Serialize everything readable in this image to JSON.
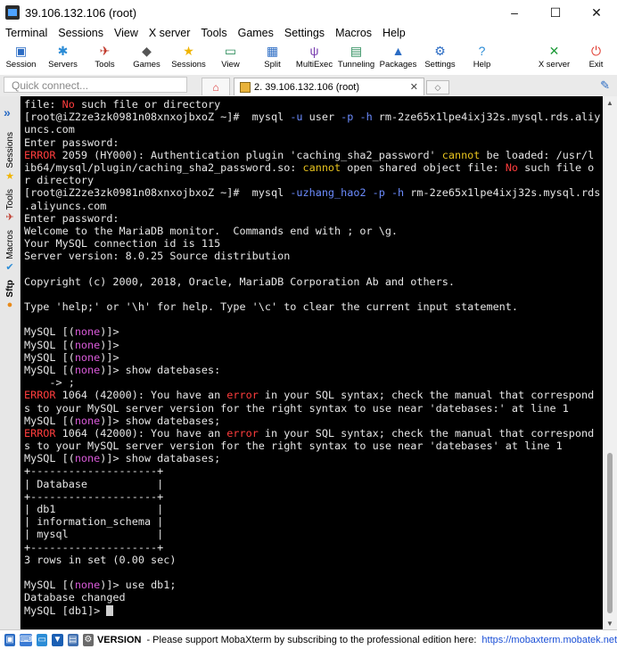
{
  "window": {
    "title": "39.106.132.106 (root)",
    "minimize": "–",
    "maximize": "☐",
    "close": "✕"
  },
  "menu": [
    "Terminal",
    "Sessions",
    "View",
    "X server",
    "Tools",
    "Games",
    "Settings",
    "Macros",
    "Help"
  ],
  "toolbar": [
    {
      "label": "Session",
      "icon": "session-icon",
      "glyph": "▣",
      "color": "#2b6cc4"
    },
    {
      "label": "Servers",
      "icon": "servers-icon",
      "glyph": "✱",
      "color": "#2b8cd6"
    },
    {
      "label": "Tools",
      "icon": "tools-icon",
      "glyph": "✈",
      "color": "#c0392b"
    },
    {
      "label": "Games",
      "icon": "games-icon",
      "glyph": "◆",
      "color": "#555555"
    },
    {
      "label": "Sessions",
      "icon": "sessions-star-icon",
      "glyph": "★",
      "color": "#f0b400"
    },
    {
      "label": "View",
      "icon": "view-icon",
      "glyph": "▭",
      "color": "#2b8c5a"
    },
    {
      "label": "Split",
      "icon": "split-icon",
      "glyph": "▦",
      "color": "#2b6cc4"
    },
    {
      "label": "MultiExec",
      "icon": "multiexec-icon",
      "glyph": "ψ",
      "color": "#7a3fb0"
    },
    {
      "label": "Tunneling",
      "icon": "tunneling-icon",
      "glyph": "▤",
      "color": "#2b8c5a"
    },
    {
      "label": "Packages",
      "icon": "packages-icon",
      "glyph": "▲",
      "color": "#2b6cc4"
    },
    {
      "label": "Settings",
      "icon": "settings-icon",
      "glyph": "⚙",
      "color": "#2b6cc4"
    },
    {
      "label": "Help",
      "icon": "help-icon",
      "glyph": "?",
      "color": "#2b8cd6"
    }
  ],
  "toolbar_right": [
    {
      "label": "X server",
      "icon": "x-server-icon",
      "glyph": "✕",
      "color": "#1f9b3a"
    },
    {
      "label": "Exit",
      "icon": "exit-power-icon",
      "glyph": "⏻",
      "color": "#e03a2f"
    }
  ],
  "tabs": {
    "quick_connect_placeholder": "Quick connect...",
    "session_tab_label": "2. 39.106.132.106 (root)",
    "session_tab_close": "✕",
    "new_tab": "◇"
  },
  "sidebar": {
    "tabs": [
      "Sessions",
      "Tools",
      "Macros",
      "Sftp"
    ]
  },
  "terminal": {
    "lines": [
      [
        {
          "t": "file: "
        },
        {
          "t": "No",
          "c": "red"
        },
        {
          "t": " such file or directory"
        }
      ],
      [
        {
          "t": "[root@iZ2ze3zk0981n08xnxojbxoZ ~]#  mysql "
        },
        {
          "t": "-u",
          "c": "blue"
        },
        {
          "t": " user "
        },
        {
          "t": "-p -h",
          "c": "blue"
        },
        {
          "t": " rm-2ze65x1lpe4ixj32s.mysql.rds.aliy"
        }
      ],
      [
        {
          "t": "uncs.com"
        }
      ],
      [
        {
          "t": "Enter password:"
        }
      ],
      [
        {
          "t": "ERROR",
          "c": "red"
        },
        {
          "t": " 2059 (HY000): Authentication plugin 'caching_sha2_password' "
        },
        {
          "t": "cannot",
          "c": "yel"
        },
        {
          "t": " be loaded: /usr/l"
        }
      ],
      [
        {
          "t": "ib64/mysql/plugin/caching_sha2_password.so: "
        },
        {
          "t": "cannot",
          "c": "yel"
        },
        {
          "t": " open shared object file: "
        },
        {
          "t": "No",
          "c": "red"
        },
        {
          "t": " such file o"
        }
      ],
      [
        {
          "t": "r directory"
        }
      ],
      [
        {
          "t": "[root@iZ2ze3zk0981n08xnxojbxoZ ~]#  mysql "
        },
        {
          "t": "-uzhang_hao2 -p -h",
          "c": "blue"
        },
        {
          "t": " rm-2ze65x1lpe4ixj32s.mysql.rds"
        }
      ],
      [
        {
          "t": ".aliyuncs.com"
        }
      ],
      [
        {
          "t": "Enter password:"
        }
      ],
      [
        {
          "t": "Welcome to the MariaDB monitor.  Commands end with ; or \\g."
        }
      ],
      [
        {
          "t": "Your MySQL connection id is 115"
        }
      ],
      [
        {
          "t": "Server version: 8.0.25 Source distribution"
        }
      ],
      [
        {
          "t": ""
        }
      ],
      [
        {
          "t": "Copyright (c) 2000, 2018, Oracle, MariaDB Corporation Ab and others."
        }
      ],
      [
        {
          "t": ""
        }
      ],
      [
        {
          "t": "Type 'help;' or '\\h' for help. Type '\\c' to clear the current input statement."
        }
      ],
      [
        {
          "t": ""
        }
      ],
      [
        {
          "t": "MySQL [("
        },
        {
          "t": "none",
          "c": "mag"
        },
        {
          "t": ")]>"
        }
      ],
      [
        {
          "t": "MySQL [("
        },
        {
          "t": "none",
          "c": "mag"
        },
        {
          "t": ")]>"
        }
      ],
      [
        {
          "t": "MySQL [("
        },
        {
          "t": "none",
          "c": "mag"
        },
        {
          "t": ")]>"
        }
      ],
      [
        {
          "t": "MySQL [("
        },
        {
          "t": "none",
          "c": "mag"
        },
        {
          "t": ")]> show datebases:"
        }
      ],
      [
        {
          "t": "    -> ;"
        }
      ],
      [
        {
          "t": "ERROR",
          "c": "red"
        },
        {
          "t": " 1064 (42000): You have an "
        },
        {
          "t": "error",
          "c": "red"
        },
        {
          "t": " in your SQL syntax; check the manual that correspond"
        }
      ],
      [
        {
          "t": "s to your MySQL server version for the right syntax to use near 'datebases:' at line 1"
        }
      ],
      [
        {
          "t": "MySQL [("
        },
        {
          "t": "none",
          "c": "mag"
        },
        {
          "t": ")]> show datebases;"
        }
      ],
      [
        {
          "t": "ERROR",
          "c": "red"
        },
        {
          "t": " 1064 (42000): You have an "
        },
        {
          "t": "error",
          "c": "red"
        },
        {
          "t": " in your SQL syntax; check the manual that correspond"
        }
      ],
      [
        {
          "t": "s to your MySQL server version for the right syntax to use near 'datebases' at line 1"
        }
      ],
      [
        {
          "t": "MySQL [("
        },
        {
          "t": "none",
          "c": "mag"
        },
        {
          "t": ")]> show databases;"
        }
      ],
      [
        {
          "t": "+--------------------+"
        }
      ],
      [
        {
          "t": "| Database           |"
        }
      ],
      [
        {
          "t": "+--------------------+"
        }
      ],
      [
        {
          "t": "| db1                |"
        }
      ],
      [
        {
          "t": "| information_schema |"
        }
      ],
      [
        {
          "t": "| mysql              |"
        }
      ],
      [
        {
          "t": "+--------------------+"
        }
      ],
      [
        {
          "t": "3 rows in set (0.00 sec)"
        }
      ],
      [
        {
          "t": ""
        }
      ],
      [
        {
          "t": "MySQL [("
        },
        {
          "t": "none",
          "c": "mag"
        },
        {
          "t": ")]> use db1;"
        }
      ],
      [
        {
          "t": "Database changed"
        }
      ],
      [
        {
          "t": "MySQL [db1]> "
        }
      ]
    ]
  },
  "status": {
    "version_label": "VERSION",
    "message": "-  Please support MobaXterm by subscribing to the professional edition here:",
    "link": "https://mobaxterm.mobatek.net"
  }
}
